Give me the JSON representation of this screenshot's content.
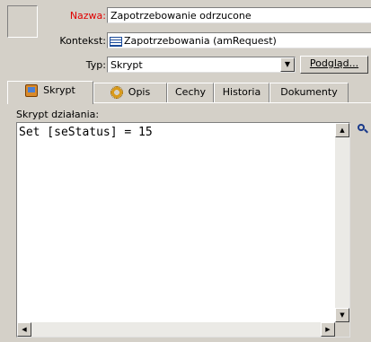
{
  "form": {
    "name_label": "Nazwa:",
    "name_value": "Zapotrzebowanie odrzucone",
    "context_label": "Kontekst:",
    "context_value": "Zapotrzebowania (amRequest)",
    "type_label": "Typ:",
    "type_value": "Skrypt",
    "preview_button": "Podgląd..."
  },
  "tabs": [
    {
      "label": "Skrypt",
      "icon": "script-icon",
      "active": true
    },
    {
      "label": "Opis",
      "icon": "gears-icon",
      "active": false
    },
    {
      "label": "Cechy",
      "active": false
    },
    {
      "label": "Historia",
      "active": false
    },
    {
      "label": "Dokumenty",
      "active": false
    }
  ],
  "script": {
    "label": "Skrypt działania:",
    "code": "Set [seStatus] = 15"
  },
  "colors": {
    "required_label": "#e00000",
    "window_bg": "#d4d0c8"
  }
}
